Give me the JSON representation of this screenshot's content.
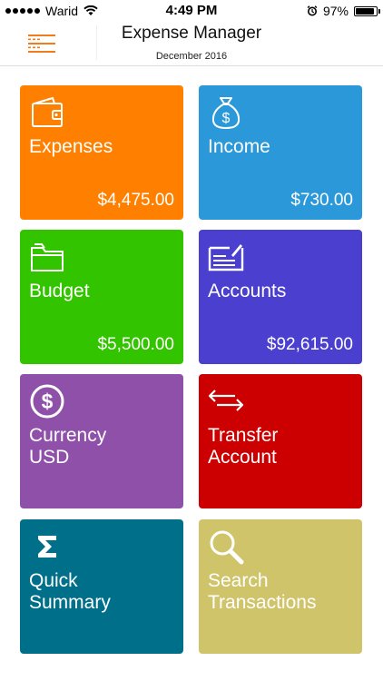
{
  "status_bar": {
    "carrier": "Warid",
    "time": "4:49 PM",
    "battery_percent": "97%",
    "battery_level": 0.97
  },
  "header": {
    "title": "Expense Manager",
    "subtitle": "December 2016",
    "menu_icon": "hamburger-menu-icon",
    "accent": "#f07c1c"
  },
  "tiles": {
    "expenses": {
      "label": "Expenses",
      "amount": "$4,475.00",
      "color": "#ff8000",
      "icon": "wallet-icon"
    },
    "income": {
      "label": "Income",
      "amount": "$730.00",
      "color": "#2b98d9",
      "icon": "money-bag-icon"
    },
    "budget": {
      "label": "Budget",
      "amount": "$5,500.00",
      "color": "#33c400",
      "icon": "folder-icon"
    },
    "accounts": {
      "label": "Accounts",
      "amount": "$92,615.00",
      "color": "#4a3fcf",
      "icon": "checkbook-icon"
    },
    "currency": {
      "label_line1": "Currency",
      "label_line2": "USD",
      "color": "#8f50a9",
      "icon": "dollar-circle-icon"
    },
    "transfer": {
      "label_line1": "Transfer",
      "label_line2": "Account",
      "color": "#cc0000",
      "icon": "transfer-arrows-icon"
    },
    "summary": {
      "label_line1": "Quick",
      "label_line2": "Summary",
      "color": "#006f8a",
      "icon": "sigma-icon"
    },
    "search": {
      "label_line1": "Search",
      "label_line2": "Transactions",
      "color": "#d0c46a",
      "icon": "magnifier-icon"
    }
  }
}
